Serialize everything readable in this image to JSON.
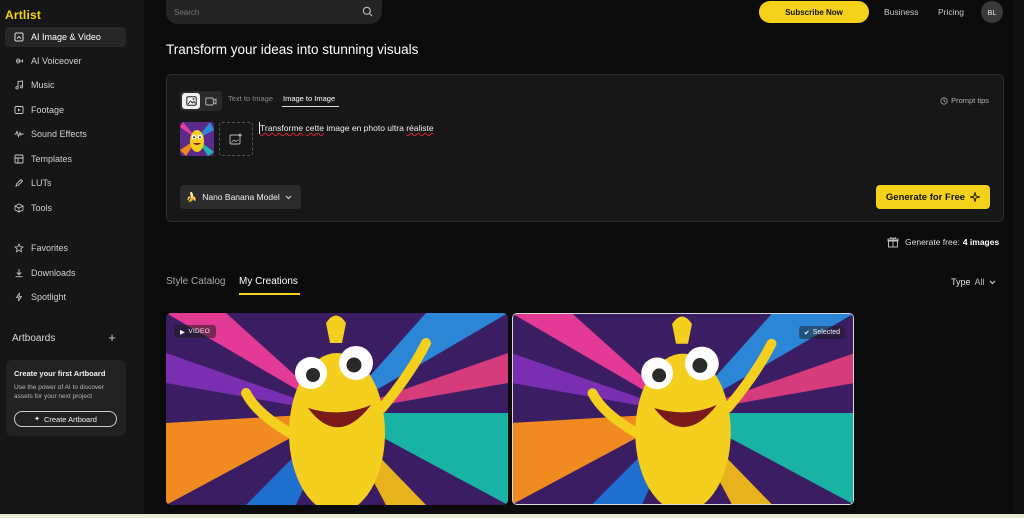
{
  "app": {
    "logo": "Artlist"
  },
  "sidebar": {
    "items": [
      {
        "label": "AI Image & Video",
        "icon": "image-video-icon",
        "active": true
      },
      {
        "label": "AI Voiceover",
        "icon": "waveform-icon"
      },
      {
        "label": "Music",
        "icon": "music-note-icon"
      },
      {
        "label": "Footage",
        "icon": "play-box-icon"
      },
      {
        "label": "Sound Effects",
        "icon": "sound-wave-icon"
      },
      {
        "label": "Templates",
        "icon": "template-icon"
      },
      {
        "label": "LUTs",
        "icon": "pen-icon"
      },
      {
        "label": "Tools",
        "icon": "cube-icon"
      },
      {
        "label": "Favorites",
        "icon": "star-icon"
      },
      {
        "label": "Downloads",
        "icon": "download-icon"
      },
      {
        "label": "Spotlight",
        "icon": "spotlight-icon"
      }
    ],
    "artboards": {
      "title": "Artboards",
      "add": "+",
      "card_title": "Create your first Artboard",
      "card_desc": "Use the power of AI to discover assets for your next project",
      "button": "Create Artboard"
    }
  },
  "header": {
    "search_placeholder": "Search",
    "subscribe": "Subscribe Now",
    "business": "Business",
    "pricing": "Pricing",
    "avatar": "BL"
  },
  "main": {
    "title": "Transform your ideas into stunning visuals",
    "prompt": {
      "tab_text_to_image": "Text to Image",
      "tab_image_to_image": "Image to Image",
      "prompt_tips": "Prompt tips",
      "text_word1": "Transforme",
      "text_word2": "cette",
      "text_mid": "image en photo ultra",
      "text_word3": "réaliste",
      "model": "Nano Banana Model",
      "generate": "Generate for Free"
    },
    "generate_free": {
      "label": "Generate free:",
      "count": "4 images"
    },
    "catalog_tabs": {
      "style": "Style Catalog",
      "mine": "My Creations"
    },
    "type_filter": {
      "label": "Type",
      "value": "All"
    },
    "cards": [
      {
        "badge": "VIDEO"
      },
      {
        "badge": "Selected"
      }
    ]
  },
  "colors": {
    "accent": "#f5d21a",
    "background": "#0b0b0b",
    "sidebar": "#161616"
  }
}
